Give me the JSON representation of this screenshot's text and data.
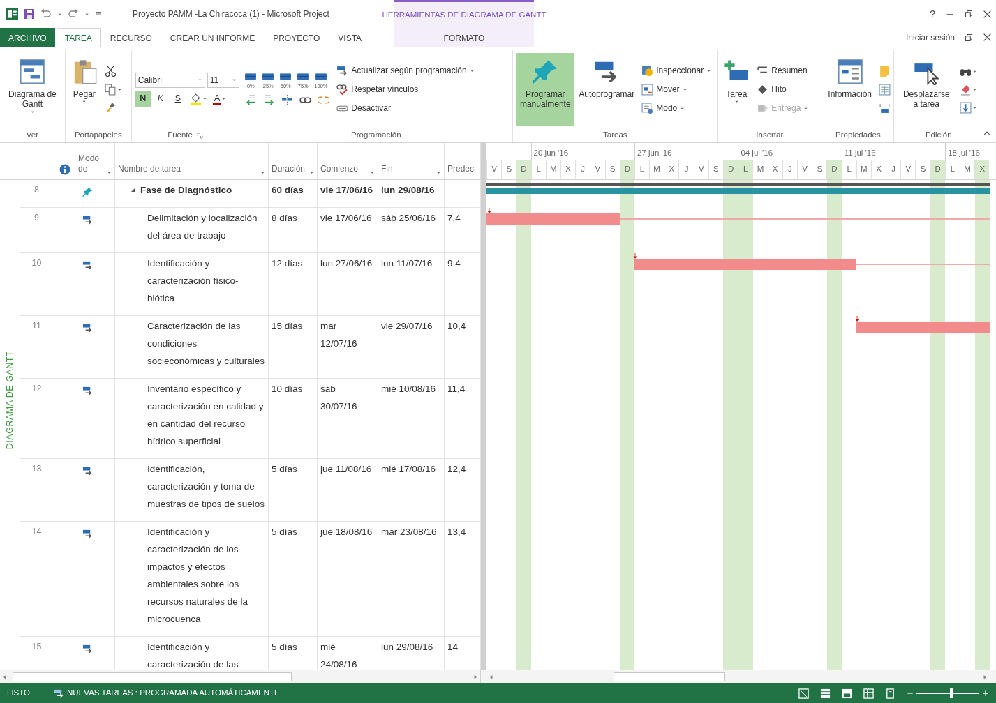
{
  "window": {
    "title": "Proyecto PAMM -La Chiracoca (1) - Microsoft Project",
    "context_group": "HERRAMIENTAS DE DIAGRAMA DE GANTT",
    "help": "?"
  },
  "tabs": [
    {
      "label": "ARCHIVO",
      "kind": "file",
      "selected": false
    },
    {
      "label": "TAREA",
      "kind": "normal",
      "selected": true
    },
    {
      "label": "RECURSO",
      "kind": "normal",
      "selected": false
    },
    {
      "label": "CREAR UN INFORME",
      "kind": "normal",
      "selected": false
    },
    {
      "label": "PROYECTO",
      "kind": "normal",
      "selected": false
    },
    {
      "label": "VISTA",
      "kind": "normal",
      "selected": false
    },
    {
      "label": "FORMATO",
      "kind": "contextual",
      "selected": false
    }
  ],
  "sign_in": "Iniciar sesión",
  "ribbon": [
    {
      "label": "Ver",
      "blocks": [
        {
          "kind": "large",
          "label": "Diagrama de Gantt",
          "dropdown": true
        }
      ]
    },
    {
      "label": "Portapapeles",
      "blocks": [
        {
          "kind": "large",
          "label": "Pegar",
          "dropdown": true
        },
        {
          "kind": "stack",
          "rows": [
            [
              {
                "kind": "icon",
                "dropdown": false
              }
            ],
            [
              {
                "kind": "icon",
                "dropdown": true
              }
            ],
            [
              {
                "kind": "icon",
                "dropdown": false
              }
            ]
          ]
        }
      ]
    },
    {
      "label": "Fuente",
      "launcher": true,
      "blocks": [
        {
          "kind": "stack",
          "rows": [
            {
              "items": [
                {
                  "kind": "combo",
                  "value": "Calibri"
                },
                {
                  "kind": "combo",
                  "value": "11"
                }
              ]
            },
            {
              "items": [
                {
                  "kind": "toggle",
                  "label": "N",
                  "selected": true
                },
                {
                  "kind": "toggle",
                  "label": "K",
                  "selected": false
                },
                {
                  "kind": "toggle",
                  "label": "S",
                  "selected": false
                },
                {
                  "kind": "icon",
                  "dropdown": true
                },
                {
                  "kind": "fontcolor",
                  "label": "A",
                  "dropdown": true
                }
              ]
            }
          ]
        }
      ]
    },
    {
      "label": "Programación",
      "blocks": [
        {
          "kind": "stack",
          "rows": [
            [
              {
                "kind": "pct",
                "label": "0%"
              },
              {
                "kind": "pct",
                "label": "25%"
              },
              {
                "kind": "pct",
                "label": "50%"
              },
              {
                "kind": "pct",
                "label": "75%"
              },
              {
                "kind": "pct",
                "label": "100%"
              }
            ],
            [
              {
                "kind": "icon",
                "dropdown": false
              },
              {
                "kind": "icon",
                "dropdown": false
              },
              {
                "kind": "icon",
                "dropdown": false
              },
              {
                "kind": "icon",
                "dropdown": false
              },
              {
                "kind": "icon",
                "dropdown": false
              }
            ]
          ]
        },
        {
          "kind": "stack",
          "rows": [
            [
              {
                "kind": "small",
                "label": "Actualizar según programación",
                "dropdown": true
              }
            ],
            [
              {
                "kind": "small",
                "label": "Respetar vínculos",
                "dropdown": false
              }
            ],
            [
              {
                "kind": "small",
                "label": "Desactivar",
                "dropdown": false
              }
            ]
          ]
        }
      ]
    },
    {
      "label": "Tareas",
      "blocks": [
        {
          "kind": "large",
          "label": "Programar manualmente",
          "dropdown": false,
          "selected": true
        },
        {
          "kind": "large",
          "label": "Autoprogramar",
          "dropdown": false,
          "selected": false
        },
        {
          "kind": "stack",
          "rows": [
            [
              {
                "kind": "small",
                "label": "Inspeccionar",
                "dropdown": true
              }
            ],
            [
              {
                "kind": "small",
                "label": "Mover",
                "dropdown": true
              }
            ],
            [
              {
                "kind": "small",
                "label": "Modo",
                "dropdown": true
              }
            ]
          ]
        }
      ]
    },
    {
      "label": "Insertar",
      "blocks": [
        {
          "kind": "large",
          "label": "Tarea",
          "dropdown": true
        },
        {
          "kind": "stack",
          "rows": [
            [
              {
                "kind": "small",
                "label": "Resumen",
                "dropdown": false,
                "disabled": false
              }
            ],
            [
              {
                "kind": "small",
                "label": "Hito",
                "dropdown": false,
                "disabled": false
              }
            ],
            [
              {
                "kind": "small",
                "label": "Entrega",
                "dropdown": true,
                "disabled": true
              }
            ]
          ]
        }
      ]
    },
    {
      "label": "Propiedades",
      "blocks": [
        {
          "kind": "large",
          "label": "Información",
          "dropdown": false
        },
        {
          "kind": "stack",
          "rows": [
            [
              {
                "kind": "icon",
                "dropdown": false
              }
            ],
            [
              {
                "kind": "icon",
                "dropdown": false
              }
            ],
            [
              {
                "kind": "icon",
                "dropdown": false
              }
            ]
          ]
        }
      ]
    },
    {
      "label": "Edición",
      "blocks": [
        {
          "kind": "large",
          "label": "Desplazarse a tarea",
          "dropdown": false
        },
        {
          "kind": "stack",
          "rows": [
            [
              {
                "kind": "icon",
                "dropdown": true
              }
            ],
            [
              {
                "kind": "icon",
                "dropdown": true
              }
            ],
            [
              {
                "kind": "icon",
                "dropdown": true
              }
            ]
          ]
        }
      ]
    }
  ],
  "view_label": "DIAGRAMA DE GANTT",
  "table": {
    "columns": [
      {
        "kind": "id"
      },
      {
        "kind": "info"
      },
      {
        "kind": "mode",
        "label": "Modo de",
        "filter": true
      },
      {
        "kind": "name",
        "label": "Nombre de tarea",
        "filter": true
      },
      {
        "kind": "duration",
        "label": "Duración",
        "filter": true
      },
      {
        "kind": "start",
        "label": "Comienzo",
        "filter": true
      },
      {
        "kind": "finish",
        "label": "Fin",
        "filter": true
      },
      {
        "kind": "predecessors",
        "label": "Predec",
        "filter": false
      }
    ],
    "tasks": [
      {
        "id": "8",
        "kind": "manual",
        "name": "Fase de Diagnóstico",
        "duration": "60 días",
        "start": "vie 17/06/16",
        "finish": "lun 29/08/16",
        "expanded": true,
        "children": [
          {
            "id": "9",
            "kind": "auto",
            "name": "Delimitación y localización del área de trabajo",
            "duration": "8 días",
            "start": "vie 17/06/16",
            "finish": "sáb 25/06/16",
            "predecessors": "7,4"
          },
          {
            "id": "10",
            "kind": "auto",
            "name": "Identificación y caracterización físico-biótica",
            "duration": "12 días",
            "start": "lun 27/06/16",
            "finish": "lun 11/07/16",
            "predecessors": "9,4"
          },
          {
            "id": "11",
            "kind": "auto",
            "name": "Caracterización de las condiciones socieconómicas y culturales",
            "duration": "15 días",
            "start": "mar 12/07/16",
            "finish": "vie 29/07/16",
            "predecessors": "10,4"
          },
          {
            "id": "12",
            "kind": "auto",
            "name": "Inventario específico y caracterización en calidad y en cantidad del recurso hídrico superficial",
            "duration": "10 días",
            "start": "sáb 30/07/16",
            "finish": "mié 10/08/16",
            "predecessors": "11,4"
          },
          {
            "id": "13",
            "kind": "auto",
            "name": "Identificación, caracterización y toma de muestras de tipos de suelos",
            "duration": "5 días",
            "start": "jue 11/08/16",
            "finish": "mié 17/08/16",
            "predecessors": "12,4"
          },
          {
            "id": "14",
            "kind": "auto",
            "name": "Identificación y caracterización de los impactos y efectos ambientales sobre los recursos naturales de la microcuenca",
            "duration": "5 días",
            "start": "jue 18/08/16",
            "finish": "mar 23/08/16",
            "predecessors": "13,4"
          },
          {
            "id": "15",
            "kind": "auto",
            "name": "Identificación y caracterización de las",
            "duration": "5 días",
            "start": "mié 24/08/16",
            "finish": "lun 29/08/16",
            "predecessors": "14"
          }
        ]
      }
    ]
  },
  "timescale": {
    "weeks": [
      {
        "label": "20 jun '16"
      },
      {
        "label": "27 jun '16"
      },
      {
        "label": "04 jul '16"
      },
      {
        "label": "11 jul '16"
      },
      {
        "label": "18 jul '16"
      }
    ],
    "days": [
      {
        "letter": "V",
        "nonworking": false
      },
      {
        "letter": "S",
        "nonworking": false
      },
      {
        "letter": "D",
        "nonworking": true
      },
      {
        "letter": "L",
        "nonworking": false
      },
      {
        "letter": "M",
        "nonworking": false
      },
      {
        "letter": "X",
        "nonworking": false
      },
      {
        "letter": "J",
        "nonworking": false
      },
      {
        "letter": "V",
        "nonworking": false
      },
      {
        "letter": "S",
        "nonworking": false
      },
      {
        "letter": "D",
        "nonworking": true
      },
      {
        "letter": "L",
        "nonworking": false
      },
      {
        "letter": "M",
        "nonworking": false
      },
      {
        "letter": "X",
        "nonworking": false
      },
      {
        "letter": "J",
        "nonworking": false
      },
      {
        "letter": "V",
        "nonworking": false
      },
      {
        "letter": "S",
        "nonworking": false
      },
      {
        "letter": "D",
        "nonworking": true
      },
      {
        "letter": "L",
        "nonworking": true
      },
      {
        "letter": "M",
        "nonworking": false
      },
      {
        "letter": "X",
        "nonworking": false
      },
      {
        "letter": "J",
        "nonworking": false
      },
      {
        "letter": "V",
        "nonworking": false
      },
      {
        "letter": "S",
        "nonworking": false
      },
      {
        "letter": "D",
        "nonworking": true
      },
      {
        "letter": "L",
        "nonworking": false
      },
      {
        "letter": "M",
        "nonworking": false
      },
      {
        "letter": "X",
        "nonworking": false
      },
      {
        "letter": "J",
        "nonworking": false
      },
      {
        "letter": "V",
        "nonworking": false
      },
      {
        "letter": "S",
        "nonworking": false
      },
      {
        "letter": "D",
        "nonworking": true
      },
      {
        "letter": "L",
        "nonworking": false
      },
      {
        "letter": "M",
        "nonworking": false
      },
      {
        "letter": "X",
        "nonworking": true
      }
    ]
  },
  "status_bar": {
    "mode": "LISTO",
    "new_tasks": "NUEVAS TAREAS : PROGRAMADA AUTOMÁTICAMENTE",
    "zoom": {
      "level": 0.55
    }
  }
}
